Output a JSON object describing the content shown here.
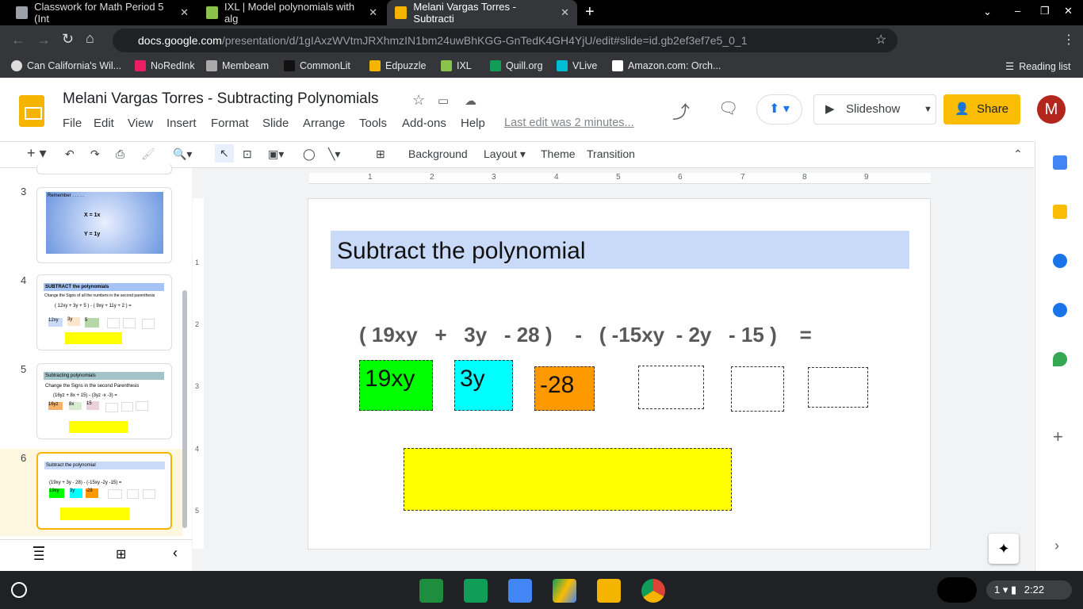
{
  "browser": {
    "tabs": [
      {
        "label": "Classwork for Math Period 5 (Int"
      },
      {
        "label": "IXL | Model polynomials with alg"
      },
      {
        "label": "Melani Vargas Torres - Subtracti",
        "active": true
      }
    ],
    "url_host": "docs.google.com",
    "url_path": "/presentation/d/1gIAxzWVtmJRXhmzIN1bm24uwBhKGG-GnTedK4GH4YjU/edit#slide=id.gb2ef3ef7e5_0_1",
    "bookmarks": [
      "Can California's Wil...",
      "NoRedInk",
      "Membeam",
      "CommonLit",
      "Edpuzzle",
      "IXL",
      "Quill.org",
      "VLive",
      "Amazon.com: Orch..."
    ],
    "reading_list": "Reading list"
  },
  "doc": {
    "title": "Melani Vargas Torres - Subtracting Polynomials",
    "menu": [
      "File",
      "Edit",
      "View",
      "Insert",
      "Format",
      "Slide",
      "Arrange",
      "Tools",
      "Add-ons",
      "Help"
    ],
    "last_edit": "Last edit was 2 minutes...",
    "slideshow": "Slideshow",
    "share": "Share",
    "avatar": "M"
  },
  "toolbar": {
    "background": "Background",
    "layout": "Layout",
    "theme": "Theme",
    "transition": "Transition"
  },
  "ruler": [
    "1",
    "2",
    "3",
    "4",
    "5",
    "6",
    "7",
    "8",
    "9"
  ],
  "vruler": [
    "1",
    "2",
    "3",
    "4",
    "5"
  ],
  "filmstrip": [
    {
      "num": "3",
      "title": "Remember . . . . .",
      "lines": [
        "X =  1x",
        "Y  =  1y"
      ]
    },
    {
      "num": "4",
      "title": "SUBTRACT  the  polynomials",
      "sub": "Change the Signs of all the numbers in the second parenthesis",
      "expr": "( 12xy + 3y + 5 )  -  ( 9xy + 11y + 2 )  =",
      "tiles": [
        "12xy",
        "3y",
        "5"
      ]
    },
    {
      "num": "5",
      "title": "Subtracting polynomials",
      "sub": "Change the Signs in the second Parenthesis",
      "expr": "(16yz + 8x + 15)  -  (3yz -x  -3)  =",
      "tiles": [
        "16yz",
        "8x",
        "15"
      ]
    },
    {
      "num": "6",
      "title": "Subtract the polynomial",
      "expr": "(19xy + 3y - 28)  -  (-15xy -2y -15)  =",
      "tiles": [
        "19xy",
        "3y",
        "-28"
      ]
    }
  ],
  "slide": {
    "title": "Subtract the polynomial",
    "expression": "( 19xy   +   3y   - 28 )    -   ( -15xy  - 2y   - 15 )    =",
    "tiles": [
      {
        "text": "19xy",
        "color": "#00ff00"
      },
      {
        "text": "3y",
        "color": "#00ffff"
      },
      {
        "text": "-28",
        "color": "#ff9900"
      }
    ],
    "answer_color": "#ffff00"
  },
  "taskbar": {
    "time": "2:22",
    "notifications": "1"
  }
}
